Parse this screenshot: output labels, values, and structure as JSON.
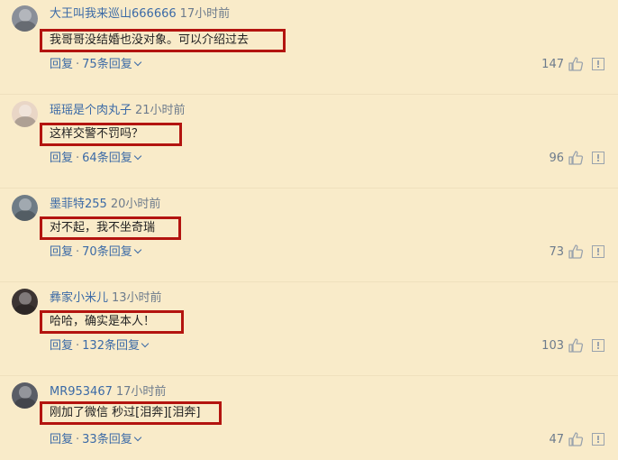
{
  "comments": [
    {
      "username": "大王叫我来巡山666666",
      "time": "17小时前",
      "content": "我哥哥没结婚也没对象。可以介绍过去",
      "reply_label": "回复",
      "separator": "·",
      "reply_count": "75条回复",
      "likes": "147",
      "avatar_color": "#8a8f99"
    },
    {
      "username": "瑶瑶是个肉丸子",
      "time": "21小时前",
      "content": "这样交警不罚吗？",
      "reply_label": "回复",
      "separator": "·",
      "reply_count": "64条回复",
      "likes": "96",
      "avatar_color": "#e9d6c6"
    },
    {
      "username": "墨菲特255",
      "time": "20小时前",
      "content": "对不起，我不坐奇瑞",
      "reply_label": "回复",
      "separator": "·",
      "reply_count": "70条回复",
      "likes": "73",
      "avatar_color": "#6f7c86"
    },
    {
      "username": "彝家小米儿",
      "time": "13小时前",
      "content": "哈哈，确实是本人！",
      "reply_label": "回复",
      "separator": "·",
      "reply_count": "132条回复",
      "likes": "103",
      "avatar_color": "#3c3433"
    },
    {
      "username": "MR953467",
      "time": "17小时前",
      "content": "刚加了微信 秒过[泪奔][泪奔]",
      "reply_label": "回复",
      "separator": "·",
      "reply_count": "33条回复",
      "likes": "47",
      "avatar_color": "#5a5d66"
    }
  ],
  "colors": {
    "background": "#f9ebc9",
    "username": "#3b6aa6",
    "highlight_border": "#b3140f",
    "muted": "#6d7b8c"
  },
  "icons": {
    "like": "thumbs-up-icon",
    "report": "report-icon",
    "expand": "chevron-down-icon"
  }
}
